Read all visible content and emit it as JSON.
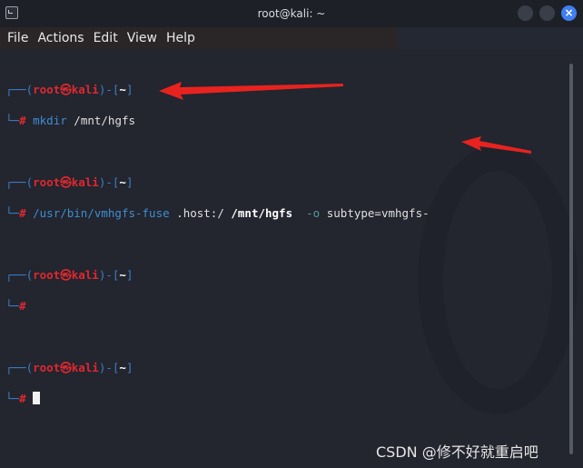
{
  "window": {
    "title": "root@kali: ~",
    "close_icon": "×"
  },
  "menu": [
    "File",
    "Actions",
    "Edit",
    "View",
    "Help"
  ],
  "prompt": {
    "open": "┌──(",
    "user": "root",
    "at": "㉿",
    "host": "kali",
    "mid": ")-[",
    "dir": "~",
    "close": "]",
    "line2": "└─",
    "hash": "#"
  },
  "commands": [
    {
      "cmd": "mkdir",
      "args": " /mnt/hgfs"
    },
    {
      "cmd": "/usr/bin/vmhgfs-fuse",
      "arg1": " .host:/ ",
      "arg2": "/mnt/hgfs",
      "opt": "  -o",
      "arg3": " subtype=vmhgfs-"
    }
  ],
  "watermark": "CSDN @修不好就重启吧",
  "arrow_color": "#e8231f"
}
